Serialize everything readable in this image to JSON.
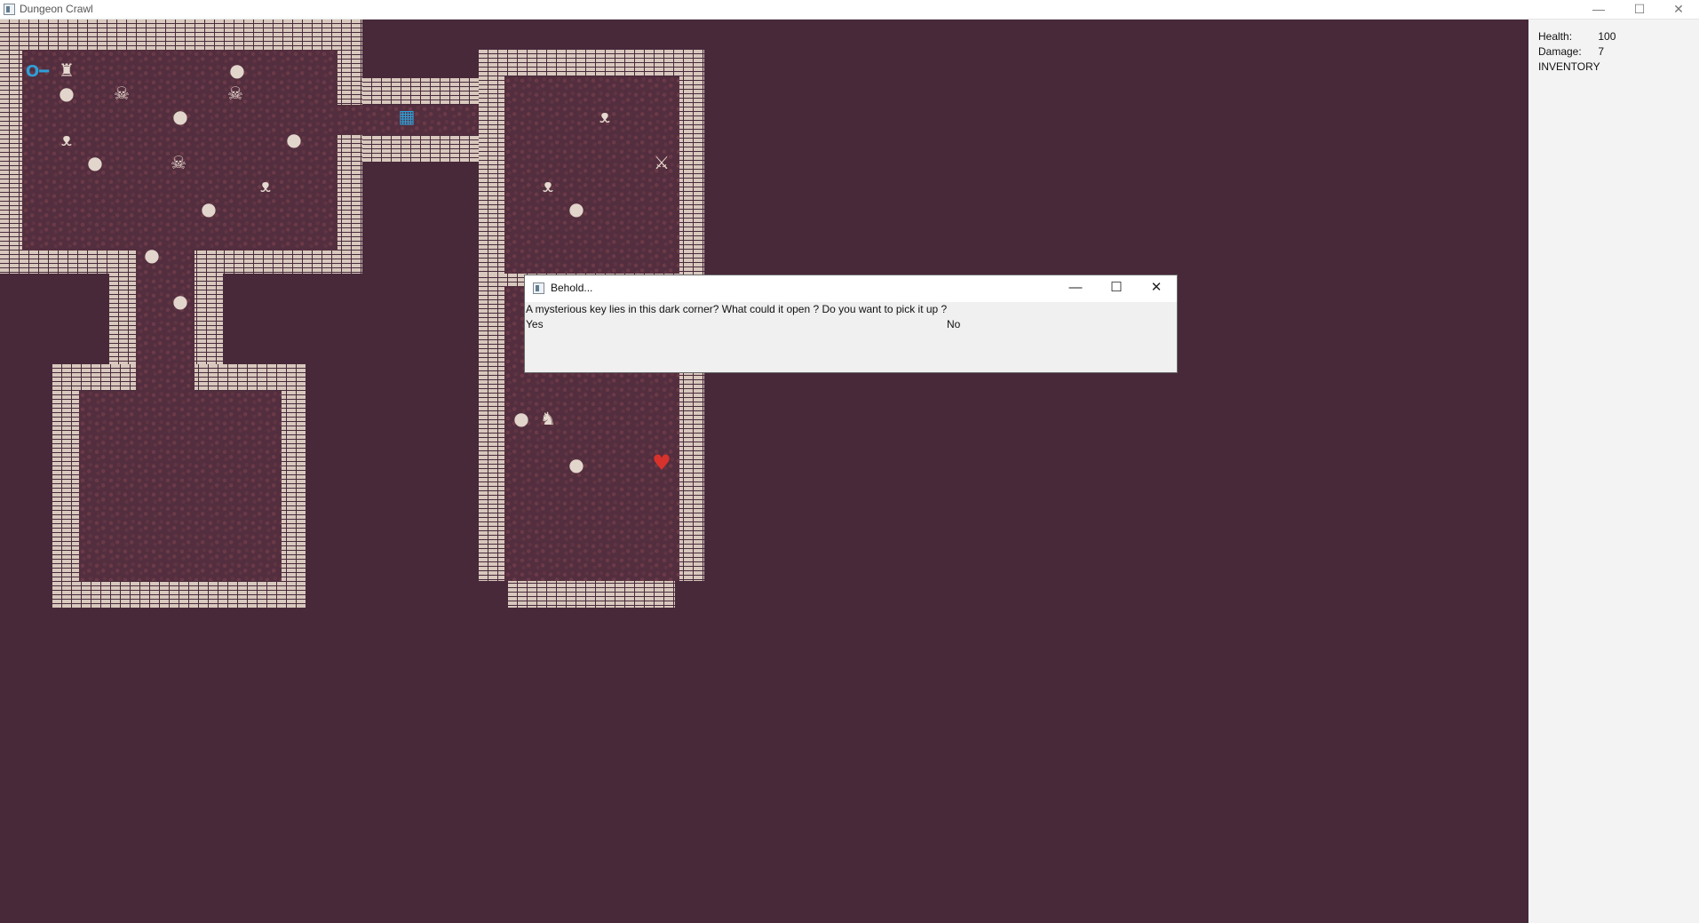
{
  "window": {
    "title": "Dungeon Crawl",
    "controls": {
      "minimize": "—",
      "maximize": "☐",
      "close": "✕"
    }
  },
  "side_panel": {
    "health_label": "Health:",
    "health_value": "100",
    "damage_label": "Damage:",
    "damage_value": "7",
    "inventory_label": "INVENTORY"
  },
  "dialog": {
    "title": "Behold...",
    "message": "A mysterious key lies in this dark corner? What could it open ? Do you want to pick it up ?",
    "yes_label": "Yes",
    "no_label": "No",
    "controls": {
      "minimize": "—",
      "maximize": "☐",
      "close": "✕"
    }
  },
  "glyphs": {
    "key": "O━",
    "player": "♜",
    "skeleton": "☠",
    "bomb": "●",
    "bat": "ᴥ",
    "gate": "▦",
    "sword": "⚔",
    "cat": "♞",
    "heart": "♥"
  },
  "colors": {
    "background": "#47293a",
    "floor": "#532e3e",
    "wall": "#d8c8bd",
    "key": "#2f9fd8",
    "heart": "#d8322c",
    "panel": "#f3f3f3"
  }
}
